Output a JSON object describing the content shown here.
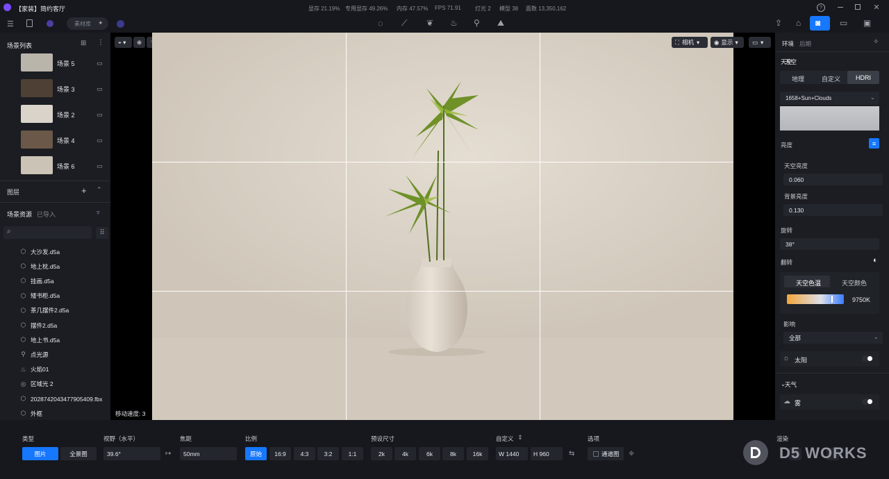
{
  "app": {
    "title": "【家装】简约客厅"
  },
  "stats": {
    "gpu": "显存 21.19%",
    "dedicated": "专用显存 49.26%",
    "memory": "内存 47.57%",
    "fps": "FPS 71.91",
    "lights": "灯光 2",
    "models": "模型 38",
    "faces": "面数 13,350,162"
  },
  "toolbar": {
    "library_label": "素材库",
    "icons": [
      "light-bulb-icon",
      "path-icon",
      "leaf-icon",
      "fire-icon",
      "spotlight-icon",
      "terrain-icon"
    ]
  },
  "scenes": {
    "title": "场景列表",
    "items": [
      {
        "label": "场景 5",
        "thumb": "#b9b5ab"
      },
      {
        "label": "场景 3",
        "thumb": "#4e4035"
      },
      {
        "label": "场景 2",
        "thumb": "#d9d3ca"
      },
      {
        "label": "场景 4",
        "thumb": "#6b5849"
      },
      {
        "label": "场景 6",
        "thumb": "#cbc3b5"
      }
    ]
  },
  "layers": {
    "title": "图层"
  },
  "assets": {
    "title": "场景资源",
    "imported": "已导入",
    "items": [
      {
        "label": "大沙发.d5a",
        "icon": "cube-icon"
      },
      {
        "label": "地上枕.d5a",
        "icon": "cube-icon"
      },
      {
        "label": "挂画.d5a",
        "icon": "cube-icon"
      },
      {
        "label": "矮书柜.d5a",
        "icon": "cube-icon"
      },
      {
        "label": "茶几摆件2.d5a",
        "icon": "cube-icon"
      },
      {
        "label": "摆件2.d5a",
        "icon": "cube-icon"
      },
      {
        "label": "地上书.d5a",
        "icon": "cube-icon"
      },
      {
        "label": "点光源",
        "icon": "pin-icon"
      },
      {
        "label": "火焰01",
        "icon": "flame-icon"
      },
      {
        "label": "区域光 2",
        "icon": "area-light-icon"
      },
      {
        "label": "2028742043477905409.fbx",
        "icon": "cube-icon"
      },
      {
        "label": "外框",
        "icon": "cube-icon"
      }
    ]
  },
  "viewport": {
    "camera_label": "相机",
    "display_label": "显示",
    "move_speed": "移动速度: 3"
  },
  "env": {
    "tab_env": "环境",
    "tab_post": "后期",
    "sky_section": "天空",
    "sky_tabs": [
      "地理",
      "自定义",
      "HDRI"
    ],
    "hdri_name": "1658+Sun+Clouds",
    "brightness": "亮度",
    "sky_brightness_label": "天空亮度",
    "sky_brightness": "0.060",
    "bg_brightness_label": "背景亮度",
    "bg_brightness": "0.130",
    "rotation_label": "旋转",
    "rotation": "38°",
    "flip_label": "翻转",
    "temp_tab": "天空色温",
    "color_tab": "天空颜色",
    "temperature": "9750K",
    "temp_fraction": 0.78,
    "influence_label": "影响",
    "influence": "全部",
    "sun_label": "太阳",
    "weather_section": "天气",
    "fog_label": "雾",
    "accent": "#1677ff"
  },
  "bottom": {
    "type_label": "类型",
    "type_image": "图片",
    "type_pano": "全景图",
    "fov_label": "视野（水平）",
    "fov": "39.6°",
    "focal_label": "焦距",
    "focal": "50mm",
    "ratio_label": "比例",
    "ratios": [
      "原始",
      "16:9",
      "4:3",
      "3:2",
      "1:1"
    ],
    "preset_label": "预设尺寸",
    "presets": [
      "2k",
      "4k",
      "6k",
      "8k",
      "16k"
    ],
    "custom_label": "自定义",
    "width": "W  1440",
    "height": "H  960",
    "options_label": "选项",
    "channel": "通道图",
    "render_label": "渲染"
  },
  "watermark": "D5 WORKS"
}
